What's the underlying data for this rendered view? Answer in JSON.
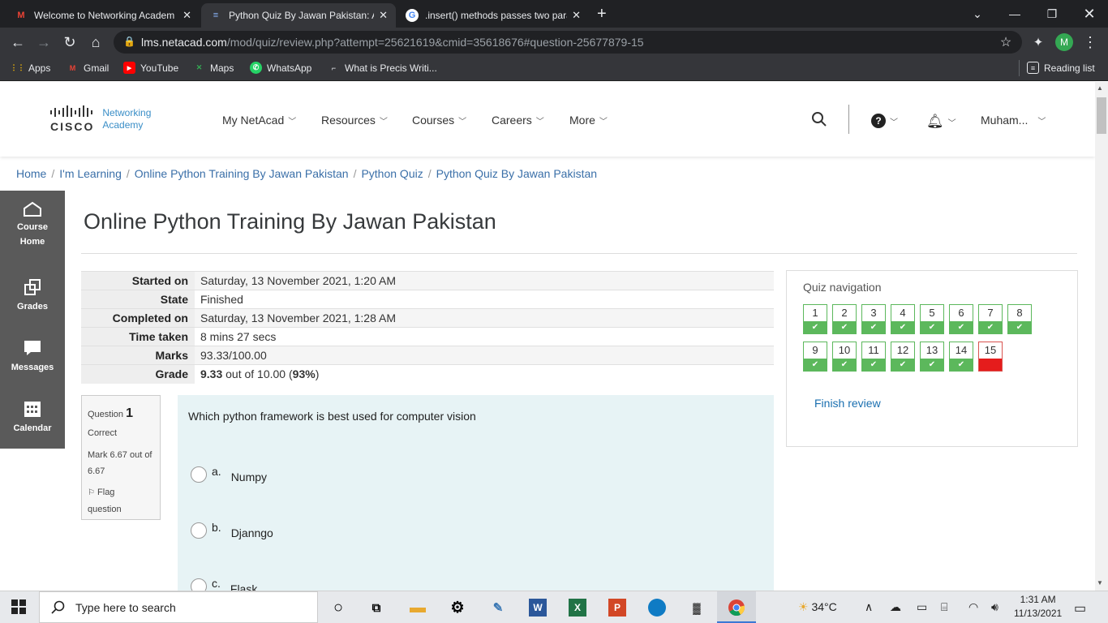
{
  "browser": {
    "tabs": [
      {
        "title": "Welcome to Networking Academ",
        "favicon": "gmail-icon"
      },
      {
        "title": "Python Quiz By Jawan Pakistan: A",
        "favicon": "netacad-icon"
      },
      {
        "title": ".insert() methods passes two para",
        "favicon": "google-icon"
      }
    ],
    "new_tab": "+",
    "url_host": "lms.netacad.com",
    "url_path": "/mod/quiz/review.php?attempt=25621619&cmid=35618676#question-25677879-15",
    "profile_initial": "M",
    "bookmarks": [
      "Apps",
      "Gmail",
      "YouTube",
      "Maps",
      "WhatsApp",
      "What is Precis Writi..."
    ],
    "reading_list": "Reading list"
  },
  "site": {
    "logo_brand": "cisco",
    "logo_text_1": "Networking",
    "logo_text_2": "Academy",
    "nav": [
      "My NetAcad",
      "Resources",
      "Courses",
      "Careers",
      "More"
    ],
    "user": "Muham..."
  },
  "breadcrumb": [
    "Home",
    "I'm Learning",
    "Online Python Training By Jawan Pakistan",
    "Python Quiz",
    "Python Quiz By Jawan Pakistan"
  ],
  "sidebar": [
    {
      "label_1": "Course",
      "label_2": "Home"
    },
    {
      "label_1": "Grades",
      "label_2": ""
    },
    {
      "label_1": "Messages",
      "label_2": ""
    },
    {
      "label_1": "Calendar",
      "label_2": ""
    }
  ],
  "page_title": "Online Python Training By Jawan Pakistan",
  "summary": [
    {
      "label": "Started on",
      "value": "Saturday, 13 November 2021, 1:20 AM"
    },
    {
      "label": "State",
      "value": "Finished"
    },
    {
      "label": "Completed on",
      "value": "Saturday, 13 November 2021, 1:28 AM"
    },
    {
      "label": "Time taken",
      "value": "8 mins 27 secs"
    },
    {
      "label": "Marks",
      "value": "93.33/100.00"
    },
    {
      "label": "Grade",
      "grade_score": "9.33",
      "grade_rest": " out of 10.00 (",
      "grade_pct": "93%",
      "grade_close": ")"
    }
  ],
  "question": {
    "label": "Question",
    "number": "1",
    "status": "Correct",
    "mark_1": "Mark 6.67 out of",
    "mark_2": "6.67",
    "flag_1": "Flag",
    "flag_2": "question",
    "text": "Which python framework is best used for computer vision",
    "options": [
      {
        "letter": "a.",
        "label": "Numpy"
      },
      {
        "letter": "b.",
        "label": "Djanngo"
      },
      {
        "letter": "c.",
        "label": "Flask"
      }
    ]
  },
  "quiz_nav": {
    "title": "Quiz navigation",
    "buttons": [
      {
        "n": "1",
        "ok": true
      },
      {
        "n": "2",
        "ok": true
      },
      {
        "n": "3",
        "ok": true
      },
      {
        "n": "4",
        "ok": true
      },
      {
        "n": "5",
        "ok": true
      },
      {
        "n": "6",
        "ok": true
      },
      {
        "n": "7",
        "ok": true
      },
      {
        "n": "8",
        "ok": true
      },
      {
        "n": "9",
        "ok": true
      },
      {
        "n": "10",
        "ok": true
      },
      {
        "n": "11",
        "ok": true
      },
      {
        "n": "12",
        "ok": true
      },
      {
        "n": "13",
        "ok": true
      },
      {
        "n": "14",
        "ok": true
      },
      {
        "n": "15",
        "ok": false
      }
    ],
    "finish": "Finish review"
  },
  "taskbar": {
    "search_placeholder": "Type here to search",
    "weather": "34°C",
    "time": "1:31 AM",
    "date": "11/13/2021"
  },
  "colors": {
    "correct": "#5cb85c",
    "incorrect": "#e51c1c",
    "link": "#3a6fa8"
  }
}
